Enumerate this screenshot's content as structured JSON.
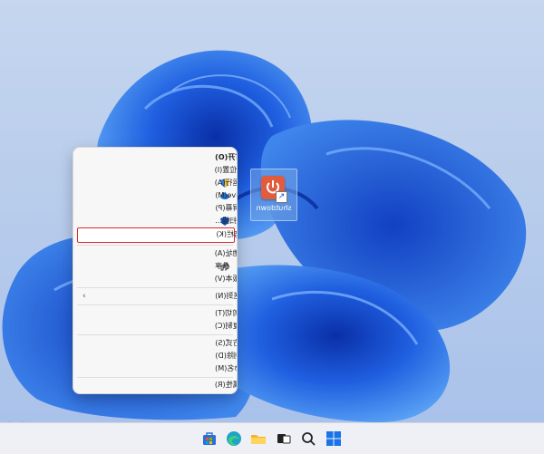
{
  "desktop": {
    "icon_label": "shutdown",
    "shortcut_glyph": "↗"
  },
  "context_menu": {
    "items": [
      {
        "label": "打开(O)",
        "icon": ""
      },
      {
        "label": "打开文件所在的位置(I)",
        "icon": ""
      },
      {
        "label": "以管理员身份运行(A)",
        "icon": "shield-icon"
      },
      {
        "label": "移动到 OneDrive(M)",
        "icon": "onedrive-cloud-icon"
      },
      {
        "label": "固定到\"开始\"屏幕(P)",
        "icon": ""
      },
      {
        "label": "使用 Microsoft Defender扫描...",
        "icon": "defender-icon"
      },
      {
        "label": "固定到任务栏(K)",
        "icon": ""
      },
      {
        "label": "复制文件地址(A)",
        "icon": ""
      },
      {
        "label": "共享",
        "icon": "share-icon"
      },
      {
        "label": "还原以前的版本(V)",
        "icon": ""
      },
      {
        "label": "发送到(N)",
        "icon": ""
      },
      {
        "label": "剪切(T)",
        "icon": ""
      },
      {
        "label": "复制(C)",
        "icon": ""
      },
      {
        "label": "创建快捷方式(S)",
        "icon": ""
      },
      {
        "label": "删除(D)",
        "icon": ""
      },
      {
        "label": "重命名(M)",
        "icon": ""
      },
      {
        "label": "属性(R)",
        "icon": ""
      }
    ],
    "highlighted_item": "固定到任务栏(K)",
    "submenu_chevron": "‹"
  },
  "taskbar": {
    "icons": [
      "windows-start-icon",
      "search-icon",
      "task-view-icon",
      "file-explorer-icon",
      "edge-browser-icon",
      "microsoft-store-icon"
    ]
  },
  "watermark": "头条",
  "colors": {
    "highlight_border": "#d92a2a",
    "wallpaper_blue": "#1f5fe0",
    "app_icon": "#e25b3c"
  }
}
